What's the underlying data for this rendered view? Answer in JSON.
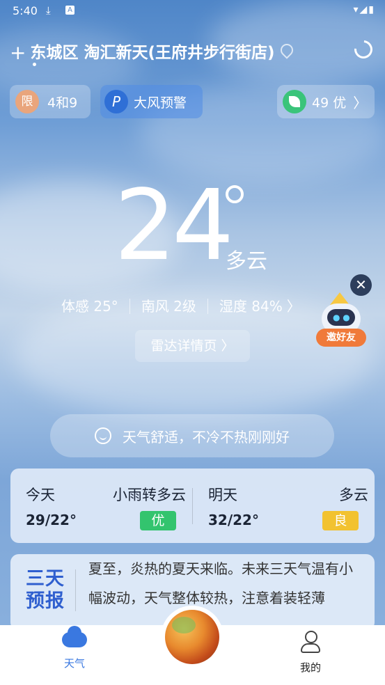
{
  "status": {
    "time": "5:40",
    "download_glyph": "⤓",
    "a_glyph": "A",
    "signal_glyphs": "▾◢▮"
  },
  "location": {
    "plus": "+",
    "name": "东城区 淘汇新天(王府井步行街店)"
  },
  "pills": {
    "limit_badge": "限",
    "limit_text": "4和9",
    "warning_text": "大风预警",
    "aqi_text": "49 优",
    "chevron": "〉"
  },
  "current": {
    "temperature": "24",
    "condition": "多云"
  },
  "details": {
    "feels": "体感  25°",
    "wind": "南风  2级",
    "humidity": "湿度  84%",
    "chevron": "〉"
  },
  "radar_label": "雷达详情页 〉",
  "robot_label": "邀好友",
  "close_glyph": "✕",
  "tip_text": "天气舒适，不冷不热刚刚好",
  "forecast": {
    "today": {
      "day": "今天",
      "condition": "小雨转多云",
      "temp": "29/22°",
      "aqi": "优"
    },
    "tomorrow": {
      "day": "明天",
      "condition": "多云",
      "temp": "32/22°",
      "aqi": "良"
    }
  },
  "colors": {
    "aqi_good": "#33c46e",
    "aqi_moderate": "#f2c230",
    "accent": "#3a78e0"
  },
  "three_day": {
    "tag": "三天预报",
    "text": "夏至，炎热的夏天来临。未来三天气温有小幅波动，天气整体较热，注意着装轻薄"
  },
  "tabbar": {
    "weather": "天气",
    "mine": "我的"
  },
  "icons": [
    "download-icon",
    "a-notification-icon",
    "wifi-icon",
    "signal-icon",
    "battery-icon",
    "plus-icon",
    "location-pin-icon",
    "refresh-icon",
    "wind-warning-icon",
    "leaf-icon",
    "smile-icon",
    "cloud-icon",
    "user-icon",
    "globe-icon",
    "close-icon"
  ]
}
